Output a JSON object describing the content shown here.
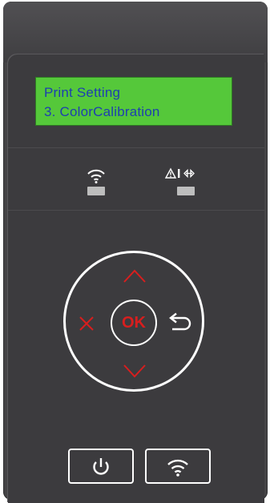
{
  "lcd": {
    "line1": "Print Setting",
    "line2": "3. ColorCalibration"
  },
  "indicators": [
    {
      "icon": "wifi-icon",
      "led": "off"
    },
    {
      "icon": "warning-error-icon",
      "led": "off"
    }
  ],
  "dpad": {
    "ok_label": "OK",
    "up_icon": "chevron-up-icon",
    "down_icon": "chevron-down-icon",
    "cancel_icon": "close-icon",
    "back_icon": "return-arrow-icon"
  },
  "buttons": {
    "power_icon": "power-icon",
    "wifi_icon": "wifi-icon"
  },
  "colors": {
    "lcd_background": "#55c83a",
    "lcd_text": "#1e3fb0",
    "accent_red": "#d81e1e",
    "panel": "#3c3b3e"
  }
}
